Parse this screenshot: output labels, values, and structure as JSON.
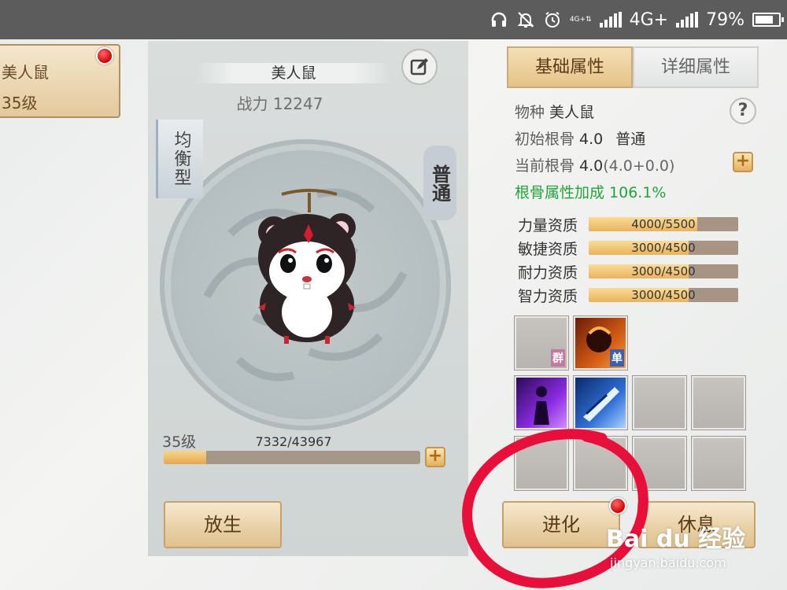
{
  "status_bar": {
    "net_small_1": "4G",
    "net_small_2": "4G+",
    "network": "4G+",
    "battery": "79%",
    "battery_level": 0.79
  },
  "pet_card": {
    "name": "美人鼠",
    "level": "35级"
  },
  "center": {
    "pet_name": "美人鼠",
    "power": "战力 12247",
    "type_tag": "均衡型",
    "quality_tag": "普通",
    "level": "35级",
    "exp_text": "7332/43967",
    "exp_fraction": 0.1667,
    "release_button": "放生"
  },
  "right": {
    "tabs": [
      {
        "label": "基础属性",
        "active": true
      },
      {
        "label": "详细属性",
        "active": false
      }
    ],
    "species_label": "物种",
    "species_value": "美人鼠",
    "initial_bone_label": "初始根骨",
    "initial_bone_value": "4.0",
    "initial_bone_grade": "普通",
    "current_bone_label": "当前根骨",
    "current_bone_value": "4.0",
    "current_bone_detail": "(4.0+0.0)",
    "bone_bonus": "根骨属性加成 106.1%",
    "stats": [
      {
        "label": "力量资质",
        "value": "4000/5500",
        "fraction": 0.727
      },
      {
        "label": "敏捷资质",
        "value": "3000/4500",
        "fraction": 0.667
      },
      {
        "label": "耐力资质",
        "value": "3000/4500",
        "fraction": 0.667
      },
      {
        "label": "智力资质",
        "value": "3000/4500",
        "fraction": 0.667
      }
    ],
    "skill_badges": {
      "group": "群",
      "single": "单"
    },
    "evolve_button": "进化",
    "rest_button": "休息"
  },
  "watermark": {
    "brand": "Bai du 经验",
    "url": "jingyan.baidu.com"
  },
  "colors": {
    "annotation_circle": "#e8103a",
    "accent_gold": "#e5c386",
    "bonus_green": "#20a53b"
  }
}
